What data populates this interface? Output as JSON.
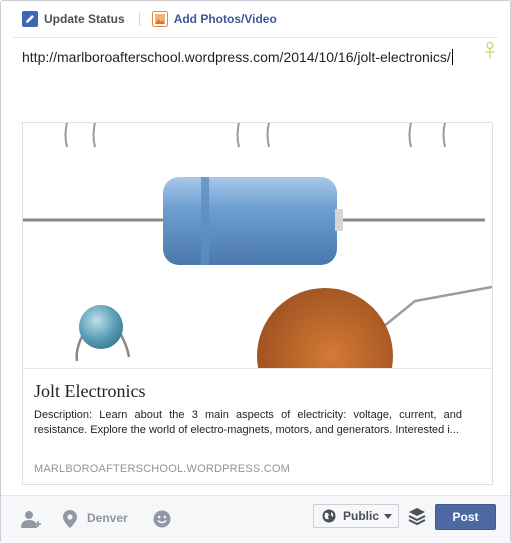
{
  "tabs": {
    "update_status": "Update Status",
    "add_photos": "Add Photos/Video"
  },
  "status_text": "http://marlboroafterschool.wordpress.com/2014/10/16/jolt-electronics/",
  "link_preview": {
    "title": "Jolt Electronics",
    "description": "Description: Learn about the 3 main aspects of electricity: voltage, current, and resistance.  Explore the world of electro-magnets, motors, and generators.    Interested i...",
    "domain": "MARLBOROAFTERSCHOOL.WORDPRESS.COM"
  },
  "bottom_bar": {
    "location": "Denver",
    "audience": "Public",
    "post_label": "Post"
  },
  "colors": {
    "brand": "#3b5998",
    "post_button": "#4e69a2",
    "capacitor_blue": "#6f9fd0",
    "resistor_brown": "#b6632a"
  },
  "icons": {
    "update_status": "pencil-icon",
    "add_photos": "photo-icon",
    "tag": "tag-people-icon",
    "tag_friends": "tag-friends-icon",
    "location": "location-pin-icon",
    "feeling": "smiley-icon",
    "audience": "globe-icon",
    "stack": "layers-icon"
  }
}
